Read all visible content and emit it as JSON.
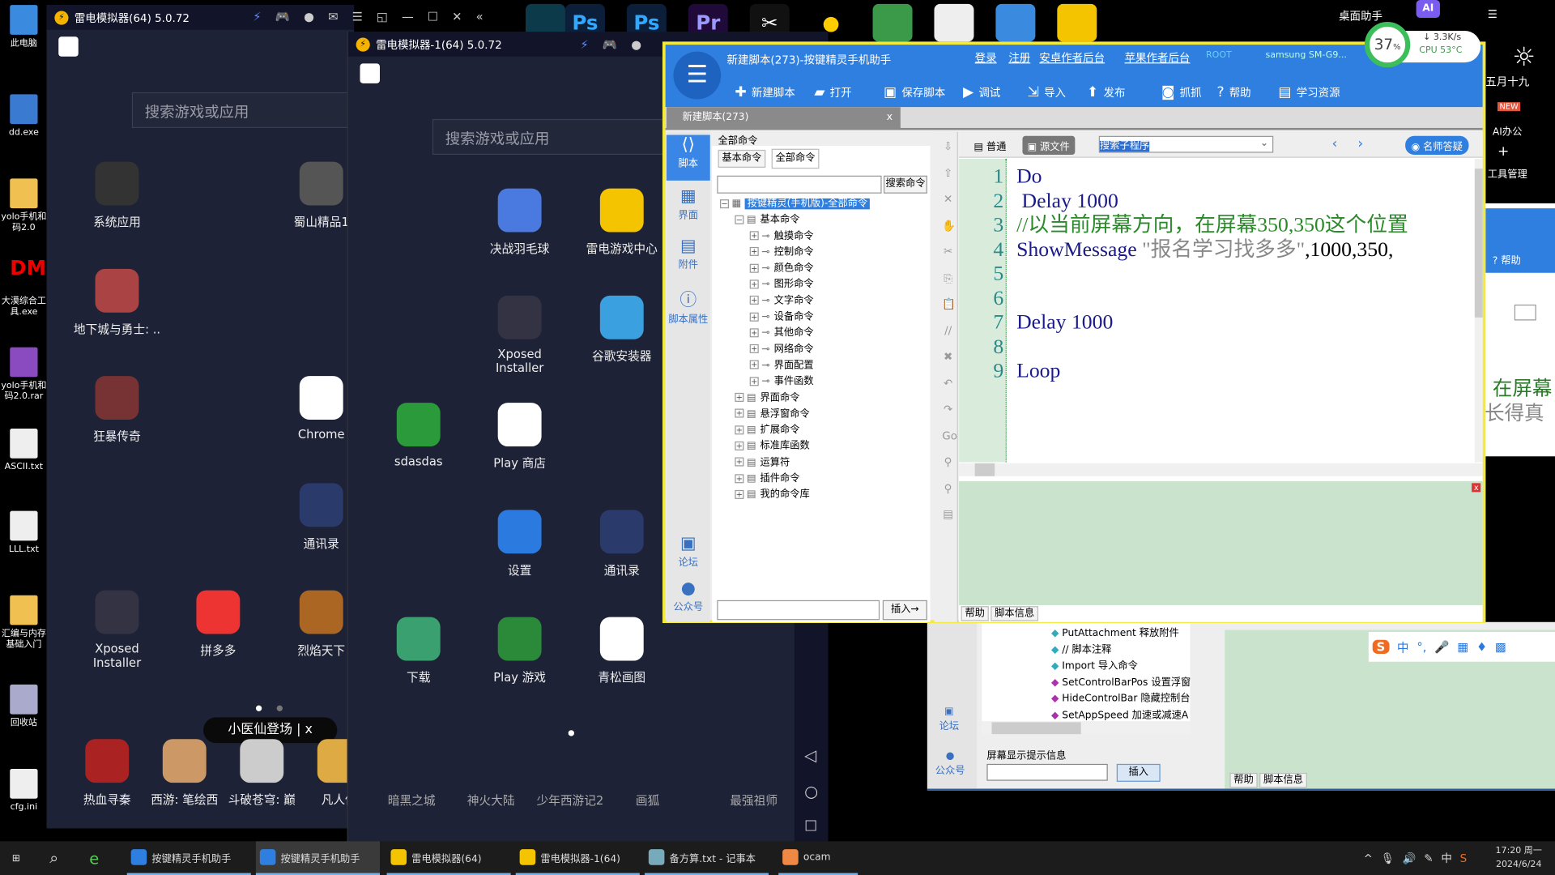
{
  "desktop_icons": [
    "此电脑",
    "dd.exe",
    "yolo手机和码2.0",
    "大漠综合工具.exe",
    "yolo手机和码2.0.rar",
    "ASCII.txt",
    "LLL.txt",
    "汇编与内存基础入门",
    "回收站",
    "cfg.ini"
  ],
  "dm_logo": "DM",
  "emulator1": {
    "title": "雷电模拟器(64) 5.0.72",
    "search_placeholder": "搜索游戏或应用",
    "apps": [
      "系统应用",
      "蜀山精品1",
      "地下城与勇士: ..",
      "狂暴传奇",
      "Chrome",
      "通讯录",
      "Xposed Installer",
      "拼多多",
      "烈焰天下"
    ],
    "popup": "小医仙登场",
    "popup_close": "x",
    "dock": [
      "热血寻秦",
      "西游: 笔绘西",
      "斗破苍穹: 巅",
      "凡人修"
    ]
  },
  "emulator2": {
    "title": "雷电模拟器-1(64) 5.0.72",
    "search_placeholder": "搜索游戏或应用",
    "apps": [
      "决战羽毛球",
      "雷电游戏中心",
      "Xposed Installer",
      "谷歌安装器",
      "sdasdas",
      "Play 商店",
      "设置",
      "通讯录",
      "下载",
      "Play 游戏",
      "青松画图"
    ],
    "dock": [
      "暗黑之城",
      "神火大陆",
      "少年西游记2",
      "画狐",
      "最强祖师"
    ]
  },
  "top_apps": [
    "Ps",
    "Ps",
    "Pr"
  ],
  "assistant": {
    "title": "桌面助手",
    "ai": "AI",
    "mem": "37",
    "mem_unit": "%",
    "net": "3.3K/s",
    "cpu": "CPU 53°C",
    "lunar": "五月十九",
    "ai_office": "AI办公",
    "new_badge": "NEW",
    "tools": "工具管理"
  },
  "main_window": {
    "title": "新建脚本(273)-按键精灵手机助手",
    "links": [
      "登录",
      "注册",
      "安卓作者后台",
      "苹果作者后台"
    ],
    "root": "ROOT",
    "device": "samsung  SM-G9...",
    "toolbar": [
      {
        "icon": "plus-icon",
        "label": "新建脚本"
      },
      {
        "icon": "folder-icon",
        "label": "打开"
      },
      {
        "icon": "save-icon",
        "label": "保存脚本"
      },
      {
        "icon": "play-icon",
        "label": "调试"
      },
      {
        "icon": "import-icon",
        "label": "导入"
      },
      {
        "icon": "publish-icon",
        "label": "发布"
      },
      {
        "icon": "camera-icon",
        "label": "抓抓"
      },
      {
        "icon": "help-icon",
        "label": "帮助"
      },
      {
        "icon": "book-icon",
        "label": "学习资源"
      }
    ],
    "tab": "新建脚本(273)",
    "tab_close": "x",
    "sidebar": [
      "脚本",
      "界面",
      "附件",
      "脚本属性",
      "论坛",
      "公众号"
    ],
    "cmd_panel": {
      "header": "全部命令",
      "tabs": [
        "基本命令",
        "全部命令"
      ],
      "search_button": "搜索命令",
      "insert_button": "插入→",
      "tree": [
        {
          "label": "按键精灵(手机版)-全部命令",
          "level": 0,
          "selected": true
        },
        {
          "label": "基本命令",
          "level": 1
        },
        {
          "label": "触摸命令",
          "level": 2
        },
        {
          "label": "控制命令",
          "level": 2
        },
        {
          "label": "颜色命令",
          "level": 2
        },
        {
          "label": "图形命令",
          "level": 2
        },
        {
          "label": "文字命令",
          "level": 2
        },
        {
          "label": "设备命令",
          "level": 2
        },
        {
          "label": "其他命令",
          "level": 2
        },
        {
          "label": "网络命令",
          "level": 2
        },
        {
          "label": "界面配置",
          "level": 2
        },
        {
          "label": "事件函数",
          "level": 2
        },
        {
          "label": "界面命令",
          "level": 1
        },
        {
          "label": "悬浮窗命令",
          "level": 1
        },
        {
          "label": "扩展命令",
          "level": 1
        },
        {
          "label": "标准库函数",
          "level": 1
        },
        {
          "label": "运算符",
          "level": 1
        },
        {
          "label": "插件命令",
          "level": 1
        },
        {
          "label": "我的命令库",
          "level": 1
        }
      ]
    },
    "editor": {
      "mode_normal": "普通",
      "mode_source": "源文件",
      "sub_search": "搜索子程序",
      "ask": "名师答疑",
      "lines": [
        "Do",
        " Delay 1000",
        "//以当前屏幕方向，在屏幕350,350这个位置",
        "ShowMessage \"报名学习找多多\",1000,350,",
        "",
        "",
        "Delay 1000",
        "",
        "Loop"
      ]
    },
    "bottom_tabs": [
      "帮助",
      "脚本信息"
    ]
  },
  "back_window": {
    "help": "帮助",
    "snippet": [
      "在屏幕",
      "长得真"
    ],
    "tree": [
      "PutAttachment 释放附件",
      "// 脚本注释",
      "Import 导入命令",
      "SetControlBarPos 设置浮窗",
      "HideControlBar 隐藏控制台",
      "SetAppSpeed 加速或减速A"
    ],
    "hint_label": "屏幕显示提示信息",
    "insert": "插入",
    "sidebar": [
      "论坛",
      "公众号"
    ],
    "bottom_tabs": [
      "帮助",
      "脚本信息"
    ],
    "ime": "中"
  },
  "taskbar": {
    "items": [
      "按键精灵手机助手",
      "按键精灵手机助手",
      "雷电模拟器(64)",
      "雷电模拟器-1(64)",
      "备方算.txt - 记事本",
      "ocam"
    ],
    "time": "17:20 周一",
    "date": "2024/6/24",
    "ime": "中"
  },
  "colors": {
    "accent": "#2f7fe0",
    "highlight_border": "#f2ea3c",
    "panel_green": "#c9e3cc"
  }
}
